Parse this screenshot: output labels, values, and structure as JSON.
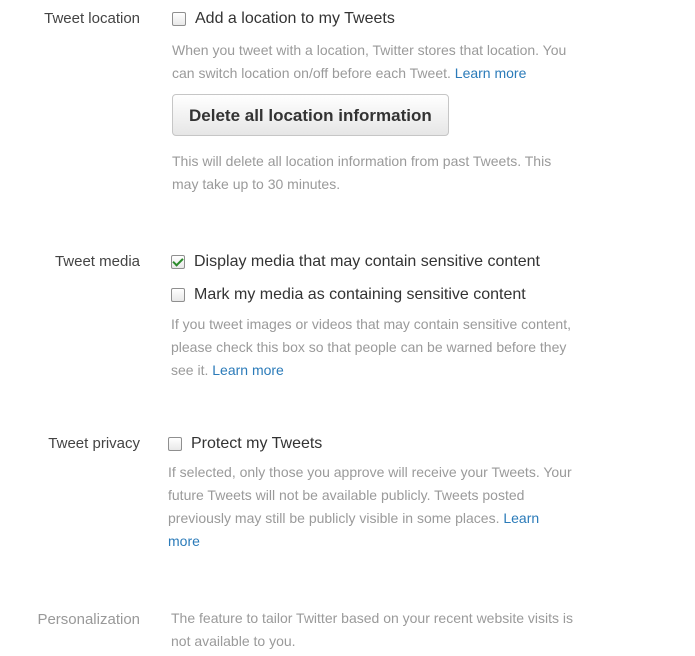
{
  "location": {
    "label": "Tweet location",
    "checkbox_label": "Add a location to my Tweets",
    "checked": false,
    "help_line1": "When you tweet with a location, Twitter stores that location. You",
    "help_line2": "can switch location on/off before each Tweet.",
    "help_link": "Learn more",
    "delete_button": "Delete all location information",
    "delete_help_line1": "This will delete all location information from past Tweets. This",
    "delete_help_line2": "may take up to 30 minutes."
  },
  "media": {
    "label": "Tweet media",
    "display_label": "Display media that may contain sensitive content",
    "display_checked": true,
    "mark_label": "Mark my media as containing sensitive content",
    "mark_checked": false,
    "help_line1": "If you tweet images or videos that may contain sensitive content,",
    "help_line2": "please check this box so that people can be warned before they",
    "help_line3": "see it.",
    "help_link": "Learn more"
  },
  "privacy": {
    "label": "Tweet privacy",
    "checkbox_label": "Protect my Tweets",
    "checked": false,
    "help_line1": "If selected, only those you approve will receive your Tweets. Your",
    "help_line2": "future Tweets will not be available publicly. Tweets posted",
    "help_line3": "previously may still be publicly visible in some places.",
    "help_link_part1": "Learn",
    "help_link_part2": "more"
  },
  "personalization": {
    "label": "Personalization",
    "help_line1": "The feature to tailor Twitter based on your recent website visits is",
    "help_line2": "not available to you."
  },
  "colors": {
    "link": "#2b7bb9",
    "help_text": "#9a9a9a",
    "check_mark": "#2a8a2a"
  }
}
